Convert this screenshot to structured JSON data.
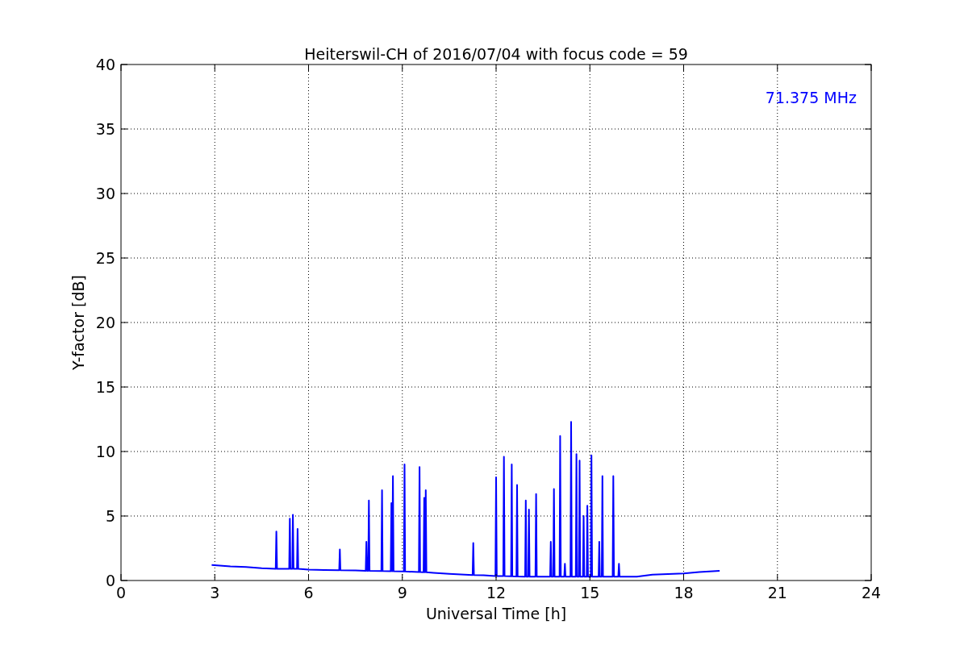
{
  "chart_data": {
    "type": "line",
    "title": "Heiterswil-CH of 2016/07/04 with focus code = 59",
    "xlabel": "Universal Time [h]",
    "ylabel": "Y-factor [dB]",
    "xlim": [
      0,
      24
    ],
    "ylim": [
      0,
      40
    ],
    "xticks": [
      0,
      3,
      6,
      9,
      12,
      15,
      18,
      21,
      24
    ],
    "yticks": [
      0,
      5,
      10,
      15,
      20,
      25,
      30,
      35,
      40
    ],
    "grid": true,
    "annotations": [
      "71.375 MHz"
    ],
    "x": [
      2.9,
      3.5,
      4.0,
      4.5,
      4.95,
      4.97,
      4.99,
      5.38,
      5.4,
      5.42,
      5.48,
      5.5,
      5.52,
      5.63,
      5.65,
      5.67,
      6.0,
      6.5,
      6.98,
      7.0,
      7.02,
      7.5,
      7.83,
      7.85,
      7.87,
      7.91,
      7.93,
      7.95,
      8.33,
      8.35,
      8.37,
      8.63,
      8.65,
      8.67,
      8.68,
      8.7,
      8.72,
      9.05,
      9.07,
      9.09,
      9.53,
      9.55,
      9.57,
      9.68,
      9.7,
      9.72,
      9.73,
      9.75,
      9.77,
      10.0,
      10.5,
      11.0,
      11.25,
      11.27,
      11.29,
      11.6,
      11.98,
      12.0,
      12.02,
      12.23,
      12.25,
      12.27,
      12.48,
      12.5,
      12.52,
      12.65,
      12.67,
      12.69,
      12.93,
      12.95,
      12.97,
      13.03,
      13.05,
      13.07,
      13.26,
      13.28,
      13.3,
      13.73,
      13.75,
      13.77,
      13.83,
      13.85,
      13.87,
      14.03,
      14.05,
      14.07,
      14.18,
      14.2,
      14.22,
      14.38,
      14.4,
      14.42,
      14.55,
      14.57,
      14.59,
      14.65,
      14.67,
      14.69,
      14.78,
      14.8,
      14.82,
      14.9,
      14.92,
      14.94,
      15.03,
      15.05,
      15.07,
      15.28,
      15.3,
      15.32,
      15.38,
      15.4,
      15.42,
      15.73,
      15.75,
      15.77,
      15.91,
      15.93,
      15.95,
      16.5,
      17.0,
      17.5,
      18.0,
      18.5,
      19.15
    ],
    "series": [
      {
        "color": "#0000ff",
        "values": [
          1.2,
          1.1,
          1.05,
          0.95,
          0.9,
          3.8,
          0.9,
          0.9,
          4.8,
          0.9,
          0.9,
          5.1,
          0.9,
          0.9,
          4.0,
          0.9,
          0.85,
          0.82,
          0.8,
          2.4,
          0.8,
          0.78,
          0.75,
          3.0,
          0.75,
          0.75,
          6.2,
          0.75,
          0.73,
          7.0,
          0.73,
          0.72,
          6.0,
          0.72,
          0.72,
          8.1,
          0.72,
          0.7,
          9.0,
          0.7,
          0.65,
          8.8,
          0.65,
          0.64,
          6.4,
          0.64,
          0.64,
          7.0,
          0.64,
          0.6,
          0.52,
          0.45,
          0.42,
          2.9,
          0.42,
          0.4,
          0.35,
          8.0,
          0.35,
          0.34,
          9.6,
          0.34,
          0.33,
          9.0,
          0.33,
          0.32,
          7.4,
          0.32,
          0.3,
          6.2,
          0.3,
          0.3,
          5.5,
          0.3,
          0.3,
          6.7,
          0.3,
          0.3,
          3.0,
          0.3,
          0.3,
          7.1,
          0.3,
          0.3,
          11.2,
          0.3,
          0.3,
          1.3,
          0.3,
          0.3,
          12.3,
          0.3,
          0.3,
          9.8,
          0.3,
          0.3,
          9.3,
          0.3,
          0.3,
          5.0,
          0.3,
          0.3,
          5.8,
          0.3,
          0.3,
          9.7,
          0.3,
          0.3,
          3.0,
          0.3,
          0.3,
          8.1,
          0.3,
          0.3,
          8.1,
          0.3,
          0.3,
          1.3,
          0.3,
          0.3,
          0.45,
          0.5,
          0.55,
          0.65,
          0.75
        ]
      }
    ]
  }
}
